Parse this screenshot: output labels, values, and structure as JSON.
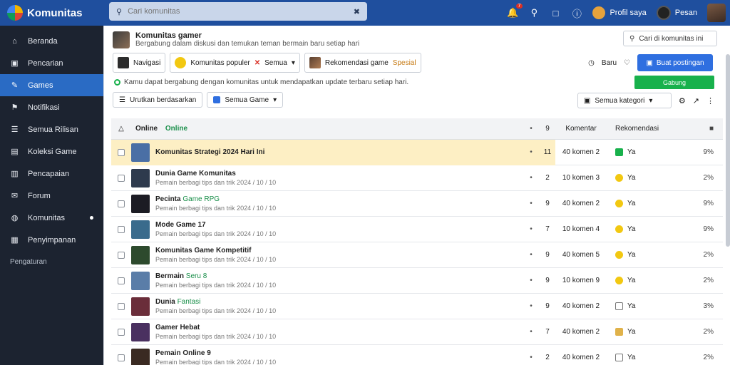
{
  "app": {
    "name": "Komunitas"
  },
  "search": {
    "placeholder": "Cari komunitas"
  },
  "topbar": {
    "notif_count": "7",
    "user1": "Profil saya",
    "user2": "Pesan"
  },
  "sidebar": {
    "items": [
      {
        "label": "Beranda",
        "icon": "home-icon"
      },
      {
        "label": "Pencarian",
        "icon": "search-icon"
      },
      {
        "label": "Games",
        "icon": "gamepad-icon",
        "active": true
      },
      {
        "label": "Notifikasi",
        "icon": "bell-icon"
      },
      {
        "label": "Semua Rilisan",
        "icon": "list-icon"
      },
      {
        "label": "Koleksi Game",
        "icon": "collection-icon"
      },
      {
        "label": "Pencapaian",
        "icon": "trophy-icon"
      },
      {
        "label": "Forum",
        "icon": "forum-icon"
      },
      {
        "label": "Komunitas",
        "icon": "globe-icon",
        "dot": true
      },
      {
        "label": "Penyimpanan",
        "icon": "storage-icon"
      }
    ],
    "footer": "Pengaturan"
  },
  "header": {
    "title": "Komunitas gamer",
    "subtitle": "Bergabung dalam diskusi dan temukan teman bermain baru setiap hari",
    "search_placeholder": "Cari di komunitas ini"
  },
  "selectors": [
    {
      "label": "Navigasi",
      "thumb": "dark"
    },
    {
      "label": "Komunitas populer",
      "extra": "Semua",
      "thumb": "yellow"
    },
    {
      "label": "Rekomendasi game",
      "extra": "Spesial",
      "thumb": "photo"
    }
  ],
  "tools": {
    "count_label": "Baru",
    "primary_button": "Buat postingan",
    "success_button": "Gabung"
  },
  "notice": "Kamu dapat bergabung dengan komunitas untuk mendapatkan update terbaru setiap hari.",
  "toolbar2": {
    "sort": "Urutkan berdasarkan",
    "filter": "Semua Game",
    "dropdown": "Semua kategori"
  },
  "table": {
    "headers": {
      "name": "Online",
      "status": "Online",
      "count": "9",
      "comments": "Komentar",
      "recommend": "Rekomendasi"
    },
    "rows": [
      {
        "name": "Komunitas Strategi 2024 Hari Ini",
        "tag": "",
        "sub": "",
        "dot": "•",
        "count": "11",
        "comments": "40 komen 2",
        "rec": "Ya",
        "rec_icon": "green",
        "end": "9%",
        "highlight": true,
        "thumb": "#4a6fa5"
      },
      {
        "name": "Dunia Game Komunitas",
        "tag": "",
        "sub": "Pemain berbagi tips dan trik 2024 / 10 / 10",
        "dot": "•",
        "count": "2",
        "comments": "10 komen 3",
        "rec": "Ya",
        "rec_icon": "yellow",
        "end": "2%",
        "thumb": "#2e3a4d"
      },
      {
        "name": "Pecinta",
        "tag": "Game RPG",
        "sub": "Pemain berbagi tips dan trik 2024 / 10 / 10",
        "dot": "•",
        "count": "9",
        "comments": "40 komen 2",
        "rec": "Ya",
        "rec_icon": "yellow",
        "end": "9%",
        "thumb": "#1c1c24"
      },
      {
        "name": "Mode Game 17",
        "tag": "",
        "sub": "Pemain berbagi tips dan trik 2024 / 10 / 10",
        "dot": "•",
        "count": "7",
        "comments": "10 komen 4",
        "rec": "Ya",
        "rec_icon": "yellow",
        "end": "9%",
        "thumb": "#3a6b8c"
      },
      {
        "name": "Komunitas Game Kompetitif",
        "tag": "",
        "sub": "Pemain berbagi tips dan trik 2024 / 10 / 10",
        "dot": "•",
        "count": "9",
        "comments": "40 komen 5",
        "rec": "Ya",
        "rec_icon": "yellow",
        "end": "2%",
        "thumb": "#2d4a2d"
      },
      {
        "name": "Bermain",
        "tag": "Seru 8",
        "sub": "Pemain berbagi tips dan trik 2024 / 10 / 10",
        "dot": "•",
        "count": "9",
        "comments": "10 komen 9",
        "rec": "Ya",
        "rec_icon": "yellow",
        "end": "2%",
        "thumb": "#5a7da8"
      },
      {
        "name": "Dunia",
        "tag": "Fantasi",
        "sub": "Pemain berbagi tips dan trik 2024 / 10 / 10",
        "dot": "•",
        "count": "9",
        "comments": "40 komen 2",
        "rec": "Ya",
        "rec_icon": "outline",
        "end": "3%",
        "thumb": "#6a2d3a"
      },
      {
        "name": "Gamer Hebat",
        "tag": "",
        "sub": "Pemain berbagi tips dan trik 2024 / 10 / 10",
        "dot": "•",
        "count": "7",
        "comments": "40 komen 2",
        "rec": "Ya",
        "rec_icon": "tan",
        "end": "2%",
        "thumb": "#4a3060"
      },
      {
        "name": "Pemain Online 9",
        "tag": "",
        "sub": "Pemain berbagi tips dan trik 2024 / 10 / 10",
        "dot": "•",
        "count": "2",
        "comments": "40 komen 2",
        "rec": "Ya",
        "rec_icon": "outline",
        "end": "2%",
        "thumb": "#3a2a22"
      }
    ]
  }
}
